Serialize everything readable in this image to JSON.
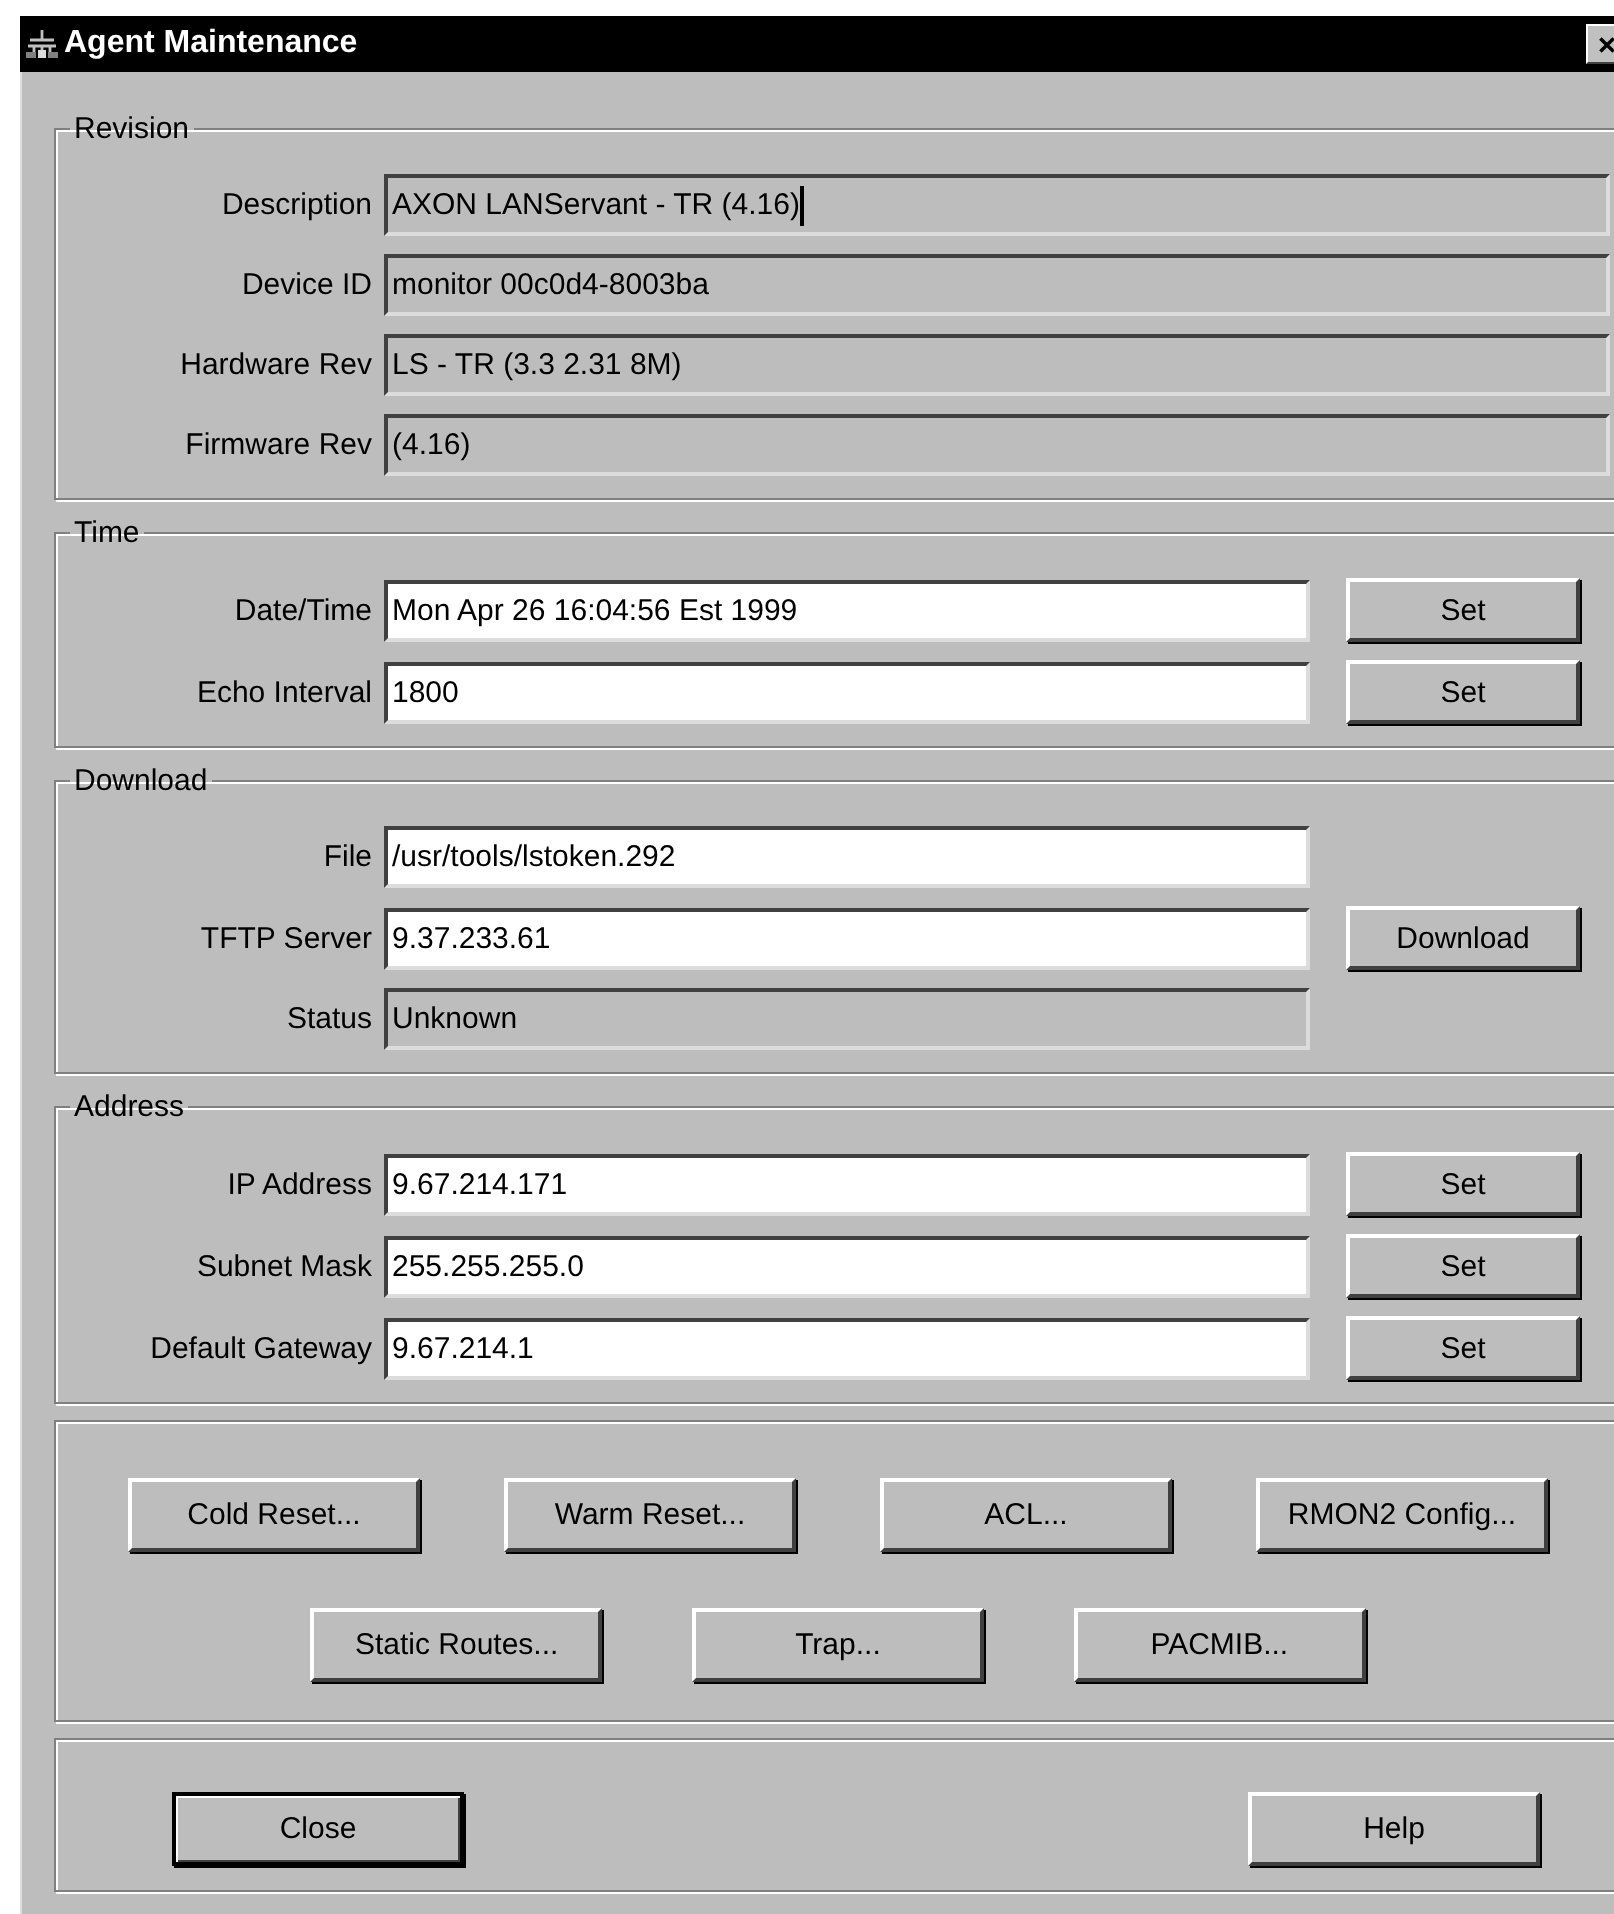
{
  "window": {
    "title": "Agent Maintenance"
  },
  "groups": [
    {
      "title": "Revision",
      "wide": true,
      "rows": [
        {
          "label": "Description",
          "value": "AXON LANServant - TR (4.16)",
          "read_only": true,
          "focused": true
        },
        {
          "label": "Device ID",
          "value": "monitor 00c0d4-8003ba",
          "read_only": true,
          "focused": false
        },
        {
          "label": "Hardware Rev",
          "value": "LS - TR (3.3 2.31 8M)",
          "read_only": true,
          "focused": false
        },
        {
          "label": "Firmware Rev",
          "value": "(4.16)",
          "read_only": true,
          "focused": false
        }
      ]
    },
    {
      "title": "Time",
      "wide": false,
      "rows": [
        {
          "label": "Date/Time",
          "value": "Mon Apr 26 16:04:56 Est 1999",
          "read_only": false,
          "focused": false,
          "button": {
            "label": "Set"
          }
        },
        {
          "label": "Echo Interval",
          "value": "1800",
          "read_only": false,
          "focused": false,
          "button": {
            "label": "Set"
          }
        }
      ]
    },
    {
      "title": "Download",
      "wide": false,
      "rows": [
        {
          "label": "File",
          "value": "/usr/tools/lstoken.292",
          "read_only": false,
          "focused": false
        },
        {
          "label": "TFTP Server",
          "value": "9.37.233.61",
          "read_only": false,
          "focused": false,
          "button": {
            "label": "Download"
          }
        },
        {
          "label": "Status",
          "value": "Unknown",
          "read_only": true,
          "focused": false
        }
      ]
    },
    {
      "title": "Address",
      "wide": false,
      "rows": [
        {
          "label": "IP Address",
          "value": "9.67.214.171",
          "read_only": false,
          "focused": false,
          "button": {
            "label": "Set"
          }
        },
        {
          "label": "Subnet Mask",
          "value": "255.255.255.0",
          "read_only": false,
          "focused": false,
          "button": {
            "label": "Set"
          }
        },
        {
          "label": "Default Gateway",
          "value": "9.67.214.1",
          "read_only": false,
          "focused": false,
          "button": {
            "label": "Set"
          }
        }
      ]
    }
  ],
  "action_rows": [
    {
      "buttons": [
        {
          "label": "Cold Reset..."
        },
        {
          "label": "Warm Reset..."
        },
        {
          "label": "ACL..."
        },
        {
          "label": "RMON2 Config..."
        }
      ]
    },
    {
      "buttons": [
        {
          "label": "Static Routes..."
        },
        {
          "label": "Trap..."
        },
        {
          "label": "PACMIB..."
        }
      ]
    }
  ],
  "footer_buttons": [
    {
      "label": "Close",
      "default": true
    },
    {
      "label": "Help",
      "default": false
    }
  ]
}
